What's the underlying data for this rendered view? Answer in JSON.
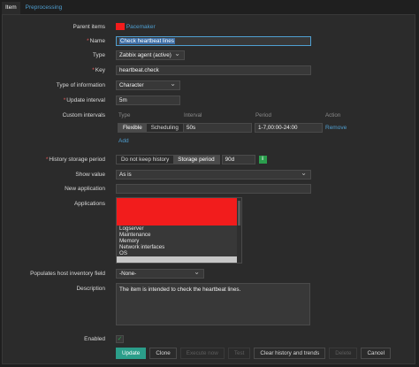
{
  "tabs": [
    {
      "label": "Item"
    },
    {
      "label": "Preprocessing"
    }
  ],
  "colors": {
    "accent": "#4f9fd1",
    "primary": "#2b9e8a",
    "redacted": "#f21c1c",
    "panel": "#2b2b2b"
  },
  "form": {
    "parent_items": {
      "label": "Parent items",
      "value": "Pacemaker"
    },
    "name": {
      "label": "Name",
      "value": "Check heartbeat lines"
    },
    "type": {
      "label": "Type",
      "value": "Zabbix agent (active)"
    },
    "key": {
      "label": "Key",
      "value": "heartbeat.check"
    },
    "type_of_information": {
      "label": "Type of information",
      "value": "Character"
    },
    "update_interval": {
      "label": "Update interval",
      "value": "5m"
    },
    "custom_intervals": {
      "label": "Custom intervals",
      "columns": [
        "Type",
        "Interval",
        "Period",
        "Action"
      ],
      "row": {
        "type_flexible": "Flexible",
        "type_scheduling": "Scheduling",
        "interval": "50s",
        "period": "1-7,00:00-24:00",
        "action": "Remove"
      },
      "add": "Add"
    },
    "history_storage_period": {
      "label": "History storage period",
      "opt_no_keep": "Do not keep history",
      "opt_storage": "Storage period",
      "value": "90d",
      "info_icon": "i"
    },
    "show_value": {
      "label": "Show value",
      "value": "As is"
    },
    "new_application": {
      "label": "New application",
      "value": ""
    },
    "applications": {
      "label": "Applications",
      "items": [
        "Logserver",
        "Maintenance",
        "Memory",
        "Network interfaces",
        "OS"
      ]
    },
    "populates_inventory": {
      "label": "Populates host inventory field",
      "value": "-None-"
    },
    "description": {
      "label": "Description",
      "value": "The item is intended to check the heartbeat lines."
    },
    "enabled": {
      "label": "Enabled",
      "checked": true,
      "mark": "✓"
    }
  },
  "buttons": {
    "update": "Update",
    "clone": "Clone",
    "execute_now": "Execute now",
    "test": "Test",
    "clear_history": "Clear history and trends",
    "delete": "Delete",
    "cancel": "Cancel"
  }
}
